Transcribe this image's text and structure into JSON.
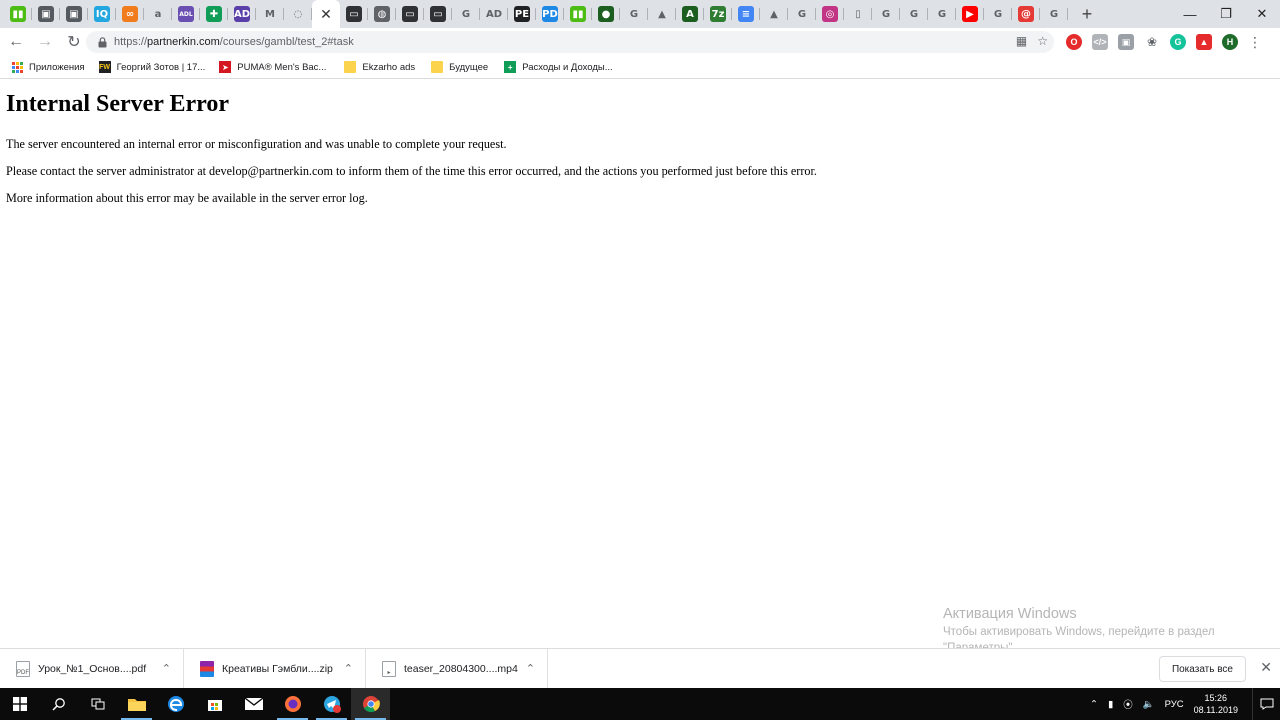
{
  "tabs": {
    "favicons": [
      {
        "icon": "houzz-icon",
        "color": "#4dbc15",
        "glyph": "▮▮"
      },
      {
        "icon": "save-icon",
        "color": "#555a60",
        "glyph": "▣"
      },
      {
        "icon": "save-icon",
        "color": "#555a60",
        "glyph": "▣"
      },
      {
        "icon": "iq-icon",
        "color": "#22a7e0",
        "glyph": "IQ"
      },
      {
        "icon": "link-icon",
        "color": "#f07c1e",
        "glyph": "∞"
      },
      {
        "icon": "a-icon",
        "color": "#ffffff",
        "glyph": "a"
      },
      {
        "icon": "adl-icon",
        "color": "#6a4fb3",
        "glyph": "ADL"
      },
      {
        "icon": "plus-icon",
        "color": "#0f9d58",
        "glyph": "✚"
      },
      {
        "icon": "ad-icon",
        "color": "#5b3fa8",
        "glyph": "AD"
      },
      {
        "icon": "gmail-icon",
        "color": "#ffffff",
        "glyph": "M"
      },
      {
        "icon": "loading-icon",
        "color": "#ffffff",
        "glyph": "◌"
      },
      {
        "icon": "globe-icon",
        "color": "#5f6368",
        "glyph": "◍"
      },
      {
        "icon": "terminal-icon",
        "color": "#303134",
        "glyph": "▭"
      },
      {
        "icon": "globe-icon",
        "color": "#5f6368",
        "glyph": "◍"
      },
      {
        "icon": "terminal-icon",
        "color": "#303134",
        "glyph": "▭"
      },
      {
        "icon": "terminal-icon",
        "color": "#303134",
        "glyph": "▭"
      },
      {
        "icon": "google-icon",
        "color": "#ffffff",
        "glyph": "G"
      },
      {
        "icon": "ad-icon",
        "color": "#ffffff",
        "glyph": "AD"
      },
      {
        "icon": "pe-icon",
        "color": "#202124",
        "glyph": "PE"
      },
      {
        "icon": "pd-icon",
        "color": "#1e88e5",
        "glyph": "PD"
      },
      {
        "icon": "houzz-icon",
        "color": "#4dbc15",
        "glyph": "▮▮"
      },
      {
        "icon": "circle-icon",
        "color": "#1b5e20",
        "glyph": "●"
      },
      {
        "icon": "google-icon",
        "color": "#ffffff",
        "glyph": "G"
      },
      {
        "icon": "android-icon",
        "color": "#ffffff",
        "glyph": "▲"
      },
      {
        "icon": "a-icon",
        "color": "#1b5e20",
        "glyph": "A"
      },
      {
        "icon": "7z-icon",
        "color": "#2e7d32",
        "glyph": "7z"
      },
      {
        "icon": "docs-icon",
        "color": "#4285f4",
        "glyph": "≡"
      },
      {
        "icon": "drive-icon",
        "color": "#ffffff",
        "glyph": "▲"
      },
      {
        "icon": "google-icon",
        "color": "#ffffff",
        "glyph": "G"
      },
      {
        "icon": "instagram-icon",
        "color": "#c13584",
        "glyph": "◎"
      },
      {
        "icon": "phone-icon",
        "color": "#ffffff",
        "glyph": "▯"
      },
      {
        "icon": "google-icon",
        "color": "#ffffff",
        "glyph": "G"
      },
      {
        "icon": "google-icon",
        "color": "#ffffff",
        "glyph": "G"
      },
      {
        "icon": "google-icon",
        "color": "#ffffff",
        "glyph": "G"
      },
      {
        "icon": "youtube-icon",
        "color": "#ff0000",
        "glyph": "▶"
      },
      {
        "icon": "google-icon",
        "color": "#ffffff",
        "glyph": "G"
      },
      {
        "icon": "at-icon",
        "color": "#e53935",
        "glyph": "@"
      },
      {
        "icon": "google-icon",
        "color": "#ffffff",
        "glyph": "G"
      }
    ],
    "active_index": 11
  },
  "toolbar": {
    "url_scheme": "https://",
    "url_host": "partnerkin.com",
    "url_path": "/courses/gambl/test_2#task"
  },
  "bookmarks": {
    "items": [
      {
        "label": "Приложения",
        "icon": "apps-grid-icon",
        "color": "#4285f4"
      },
      {
        "label": "Георгий Зотов | 17...",
        "icon": "fw-icon",
        "color": "#202124"
      },
      {
        "label": "PUMA® Men's Bac...",
        "icon": "puma-icon",
        "color": "#d3161f"
      },
      {
        "label": "Ekzarho ads",
        "icon": "folder-icon",
        "color": "#fbd34d"
      },
      {
        "label": "Будущее",
        "icon": "folder-icon",
        "color": "#fbd34d"
      },
      {
        "label": "Расходы и Доходы...",
        "icon": "sheets-icon",
        "color": "#0f9d58"
      }
    ]
  },
  "page": {
    "heading": "Internal Server Error",
    "paragraphs": [
      "The server encountered an internal error or misconfiguration and was unable to complete your request.",
      "Please contact the server administrator at develop@partnerkin.com to inform them of the time this error occurred, and the actions you performed just before this error.",
      "More information about this error may be available in the server error log."
    ]
  },
  "watermark": {
    "title": "Активация Windows",
    "subtitle": "Чтобы активировать Windows, перейдите в раздел \"Параметры\"."
  },
  "downloads": {
    "items": [
      {
        "name": "Урок_№1_Основ....pdf",
        "icon": "pdf-file-icon"
      },
      {
        "name": "Креативы Гэмбли....zip",
        "icon": "winrar-icon"
      },
      {
        "name": "teaser_20804300....mp4",
        "icon": "video-file-icon"
      }
    ],
    "show_all": "Показать все"
  },
  "taskbar": {
    "language": "РУС",
    "time": "15:26",
    "date": "08.11.2019"
  }
}
